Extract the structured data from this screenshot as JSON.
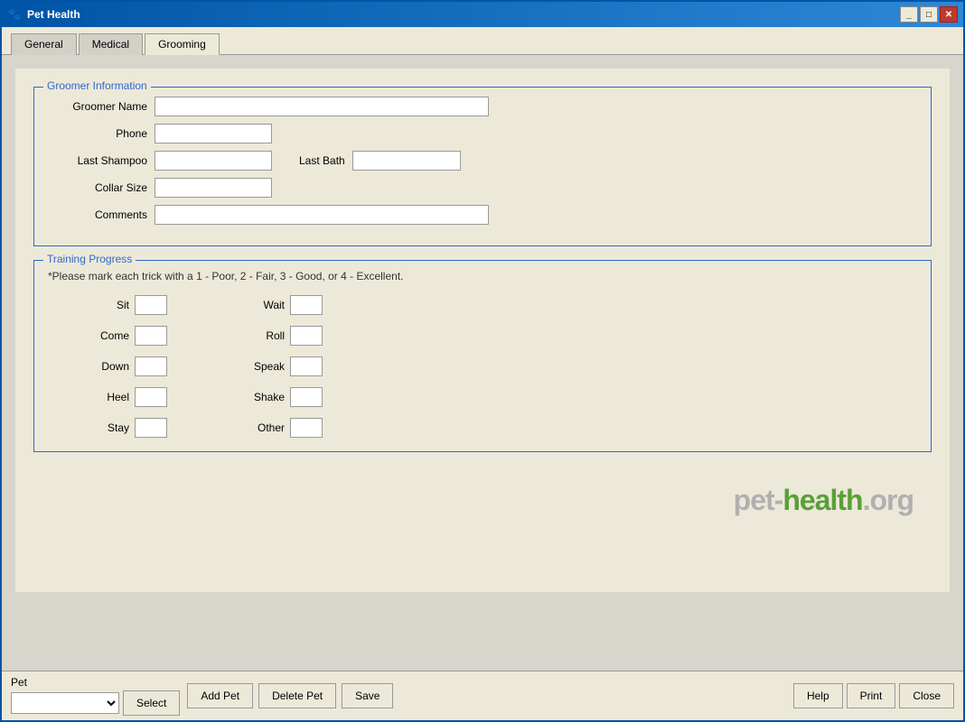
{
  "window": {
    "title": "Pet Health",
    "icon": "🐾"
  },
  "titlebar": {
    "title": "Pet Health",
    "minimize_label": "_",
    "restore_label": "□",
    "close_label": "✕"
  },
  "tabs": [
    {
      "id": "general",
      "label": "General",
      "active": false
    },
    {
      "id": "medical",
      "label": "Medical",
      "active": false
    },
    {
      "id": "grooming",
      "label": "Grooming",
      "active": true
    }
  ],
  "groomer_section": {
    "title": "Groomer Information",
    "fields": {
      "groomer_name_label": "Groomer Name",
      "phone_label": "Phone",
      "last_shampoo_label": "Last Shampoo",
      "last_bath_label": "Last Bath",
      "collar_size_label": "Collar Size",
      "comments_label": "Comments"
    },
    "values": {
      "groomer_name": "",
      "phone": "",
      "last_shampoo": "",
      "last_bath": "",
      "collar_size": "",
      "comments": ""
    }
  },
  "training_section": {
    "title": "Training Progress",
    "note": "*Please mark each trick with a 1 - Poor, 2 - Fair, 3 - Good, or 4 - Excellent.",
    "tricks_left": [
      {
        "id": "sit",
        "label": "Sit",
        "value": ""
      },
      {
        "id": "come",
        "label": "Come",
        "value": ""
      },
      {
        "id": "down",
        "label": "Down",
        "value": ""
      },
      {
        "id": "heel",
        "label": "Heel",
        "value": ""
      },
      {
        "id": "stay",
        "label": "Stay",
        "value": ""
      }
    ],
    "tricks_right": [
      {
        "id": "wait",
        "label": "Wait",
        "value": ""
      },
      {
        "id": "roll",
        "label": "Roll",
        "value": ""
      },
      {
        "id": "speak",
        "label": "Speak",
        "value": ""
      },
      {
        "id": "shake",
        "label": "Shake",
        "value": ""
      },
      {
        "id": "other",
        "label": "Other",
        "value": ""
      }
    ]
  },
  "logo": {
    "part1": "pet-",
    "part2": "health",
    "part3": ".org"
  },
  "footer": {
    "pet_label": "Pet",
    "select_button": "Select",
    "add_pet_button": "Add Pet",
    "delete_pet_button": "Delete Pet",
    "save_button": "Save",
    "help_button": "Help",
    "print_button": "Print",
    "close_button": "Close"
  }
}
